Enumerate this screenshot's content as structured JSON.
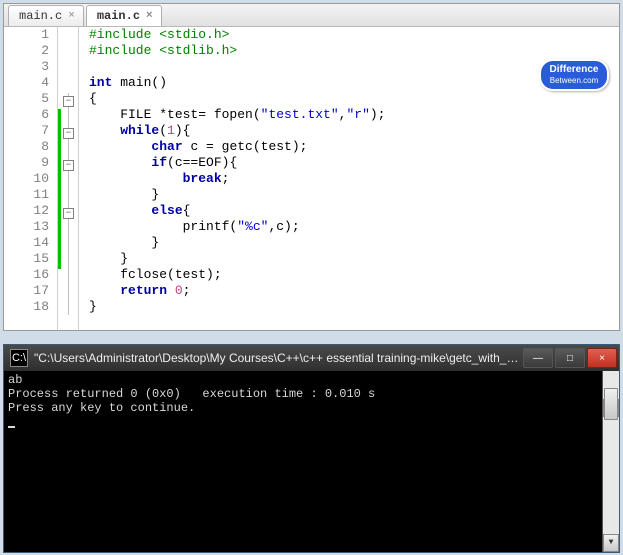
{
  "tabs": [
    {
      "label": "main.c",
      "active": false
    },
    {
      "label": "main.c",
      "active": true
    }
  ],
  "code_lines": [
    {
      "n": 1,
      "frags": [
        {
          "cls": "pp",
          "t": "#include <stdio.h>"
        }
      ]
    },
    {
      "n": 2,
      "frags": [
        {
          "cls": "pp",
          "t": "#include <stdlib.h>"
        }
      ]
    },
    {
      "n": 3,
      "frags": [
        {
          "cls": "txt",
          "t": ""
        }
      ]
    },
    {
      "n": 4,
      "frags": [
        {
          "cls": "kw",
          "t": "int"
        },
        {
          "cls": "txt",
          "t": " main()"
        }
      ]
    },
    {
      "n": 5,
      "frags": [
        {
          "cls": "txt",
          "t": "{"
        }
      ]
    },
    {
      "n": 6,
      "frags": [
        {
          "cls": "txt",
          "t": "    FILE *test= fopen("
        },
        {
          "cls": "str",
          "t": "\"test.txt\""
        },
        {
          "cls": "txt",
          "t": ","
        },
        {
          "cls": "str",
          "t": "\"r\""
        },
        {
          "cls": "txt",
          "t": ");"
        }
      ]
    },
    {
      "n": 7,
      "frags": [
        {
          "cls": "txt",
          "t": "    "
        },
        {
          "cls": "kw",
          "t": "while"
        },
        {
          "cls": "txt",
          "t": "("
        },
        {
          "cls": "num",
          "t": "1"
        },
        {
          "cls": "txt",
          "t": "){"
        }
      ]
    },
    {
      "n": 8,
      "frags": [
        {
          "cls": "txt",
          "t": "        "
        },
        {
          "cls": "kw",
          "t": "char"
        },
        {
          "cls": "txt",
          "t": " c = getc(test);"
        }
      ]
    },
    {
      "n": 9,
      "frags": [
        {
          "cls": "txt",
          "t": "        "
        },
        {
          "cls": "kw",
          "t": "if"
        },
        {
          "cls": "txt",
          "t": "(c==EOF){"
        }
      ]
    },
    {
      "n": 10,
      "frags": [
        {
          "cls": "txt",
          "t": "            "
        },
        {
          "cls": "kw",
          "t": "break"
        },
        {
          "cls": "txt",
          "t": ";"
        }
      ]
    },
    {
      "n": 11,
      "frags": [
        {
          "cls": "txt",
          "t": "        }"
        }
      ]
    },
    {
      "n": 12,
      "frags": [
        {
          "cls": "txt",
          "t": "        "
        },
        {
          "cls": "kw",
          "t": "else"
        },
        {
          "cls": "txt",
          "t": "{"
        }
      ]
    },
    {
      "n": 13,
      "frags": [
        {
          "cls": "txt",
          "t": "            printf("
        },
        {
          "cls": "str",
          "t": "\"%c\""
        },
        {
          "cls": "txt",
          "t": ",c);"
        }
      ]
    },
    {
      "n": 14,
      "frags": [
        {
          "cls": "txt",
          "t": "        }"
        }
      ]
    },
    {
      "n": 15,
      "frags": [
        {
          "cls": "txt",
          "t": "    }"
        }
      ]
    },
    {
      "n": 16,
      "frags": [
        {
          "cls": "txt",
          "t": "    fclose(test);"
        }
      ]
    },
    {
      "n": 17,
      "frags": [
        {
          "cls": "txt",
          "t": "    "
        },
        {
          "cls": "kw",
          "t": "return"
        },
        {
          "cls": "txt",
          "t": " "
        },
        {
          "cls": "num",
          "t": "0"
        },
        {
          "cls": "txt",
          "t": ";"
        }
      ]
    },
    {
      "n": 18,
      "frags": [
        {
          "cls": "txt",
          "t": "}"
        }
      ]
    }
  ],
  "fold_marks": [
    5,
    7,
    9,
    12
  ],
  "change_range": [
    6,
    15
  ],
  "badge": {
    "line1": "Difference",
    "line2": "Between.com"
  },
  "console": {
    "title": "\"C:\\Users\\Administrator\\Desktop\\My Courses\\C++\\c++ essential training-mike\\getc_with_files_m...",
    "line1": "ab",
    "line2": "Process returned 0 (0x0)   execution time : 0.010 s",
    "line3": "Press any key to continue."
  },
  "icons": {
    "close": "×",
    "min": "—",
    "max": "□",
    "up": "▲",
    "down": "▼",
    "cmd": "C:\\"
  }
}
